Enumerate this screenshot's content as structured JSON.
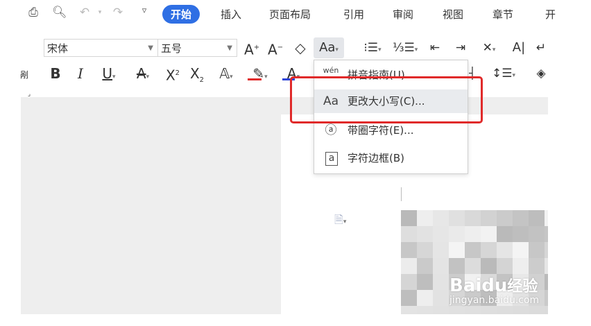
{
  "menu": {
    "tabs": [
      "开始",
      "插入",
      "页面布局",
      "引用",
      "审阅",
      "视图",
      "章节"
    ],
    "truncated_tab": "开",
    "active_index": 0
  },
  "ribbon": {
    "font_name": "宋体",
    "font_size": "五号",
    "case_button": "Aa",
    "left_edge_label": "剐"
  },
  "dropdown": {
    "items": [
      {
        "icon": "wén",
        "label": "拼音指南(U)..."
      },
      {
        "icon": "Aa",
        "label": "更改大小写(C)..."
      },
      {
        "icon": "ⓐ",
        "label": "带圈字符(E)..."
      },
      {
        "icon": "a",
        "label": "字符边框(B)"
      }
    ],
    "highlighted_index": 1
  },
  "watermark": {
    "brand_a": "Bai",
    "brand_b": "du",
    "brand_c": "经验",
    "url": "jingyan.baidu.com"
  },
  "colors": {
    "accent": "#2f6fe4",
    "highlight_box": "#e02a2a",
    "underline_red": "#e02a2a",
    "underline_blue": "#2f45d8"
  }
}
